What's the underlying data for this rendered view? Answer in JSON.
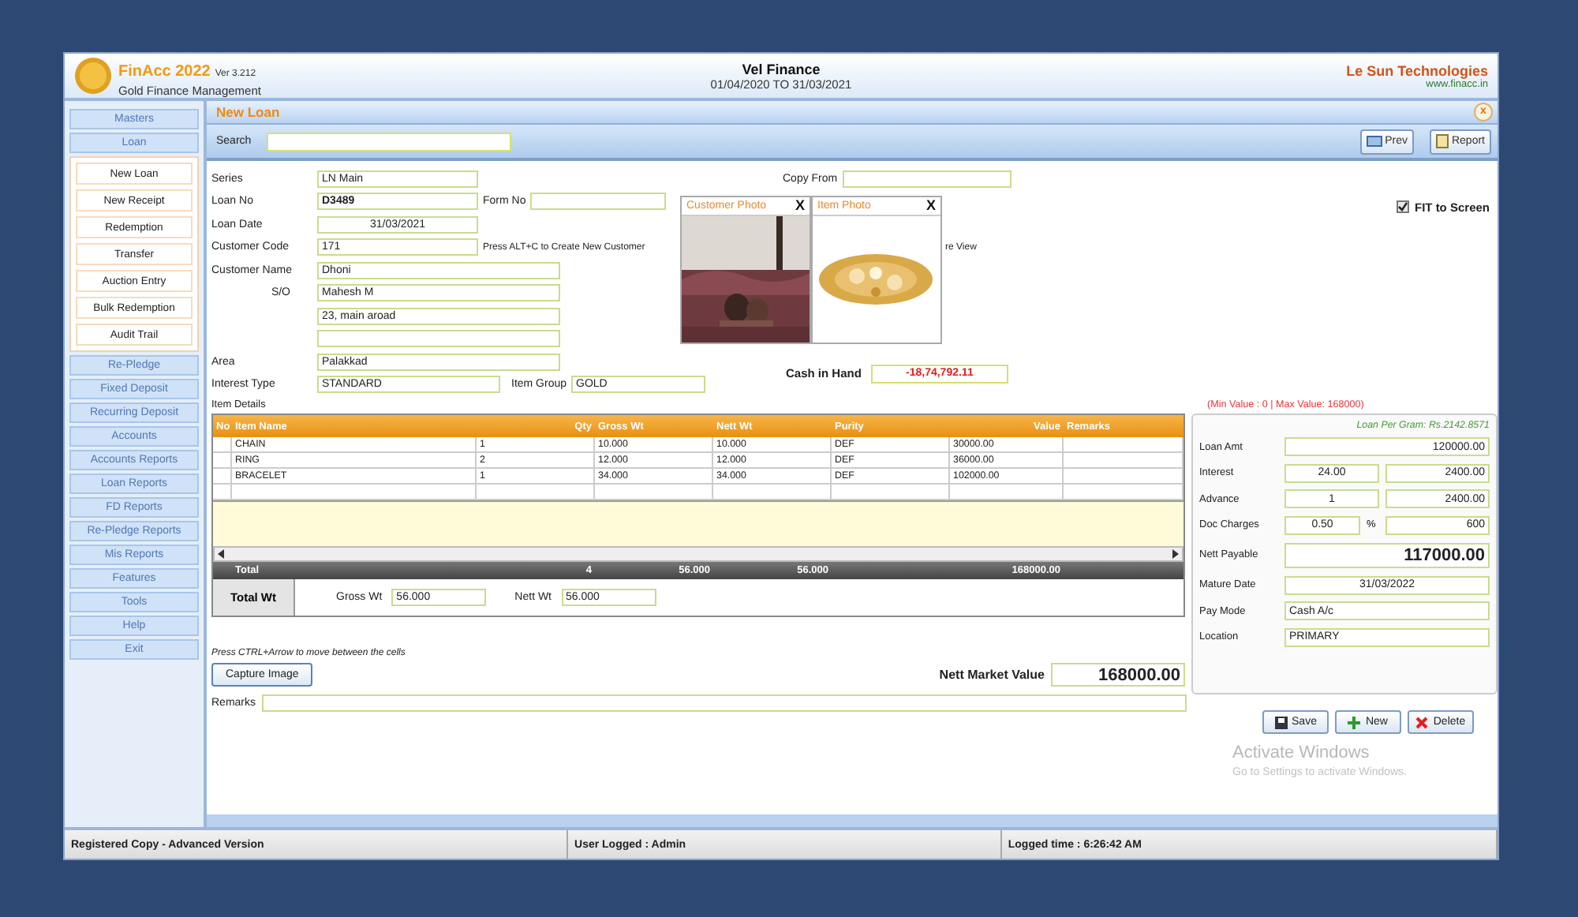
{
  "header": {
    "app_name": "FinAcc 2022",
    "version": "Ver 3.212",
    "subtitle": "Gold Finance Management",
    "company": "Vel Finance",
    "period": "01/04/2020 TO 31/03/2021",
    "vendor": "Le Sun Technologies",
    "website": "www.finacc.in"
  },
  "sidebar": {
    "items": [
      {
        "label": "Masters"
      },
      {
        "label": "Loan",
        "children": [
          {
            "label": "New Loan"
          },
          {
            "label": "New Receipt"
          },
          {
            "label": "Redemption"
          },
          {
            "label": "Transfer"
          },
          {
            "label": "Auction Entry"
          },
          {
            "label": "Bulk Redemption"
          },
          {
            "label": "Audit Trail"
          }
        ]
      },
      {
        "label": "Re-Pledge"
      },
      {
        "label": "Fixed Deposit"
      },
      {
        "label": "Recurring Deposit"
      },
      {
        "label": "Accounts"
      },
      {
        "label": "Accounts Reports"
      },
      {
        "label": "Loan Reports"
      },
      {
        "label": "FD Reports"
      },
      {
        "label": "Re-Pledge Reports"
      },
      {
        "label": "Mis Reports"
      },
      {
        "label": "Features"
      },
      {
        "label": "Tools"
      },
      {
        "label": "Help"
      },
      {
        "label": "Exit"
      }
    ]
  },
  "form": {
    "title": "New Loan",
    "close": "x",
    "search": {
      "label": "Search"
    },
    "toolbar": [
      {
        "label": "Prev",
        "kind": "prev"
      },
      {
        "label": "Report",
        "kind": "report"
      }
    ],
    "series": {
      "label": "Series",
      "value": "LN Main"
    },
    "loan_no": {
      "label": "Loan No",
      "value": "D3489"
    },
    "form_no": {
      "label": "Form No"
    },
    "loan_date": {
      "label": "Loan Date",
      "value": "31/03/2021"
    },
    "customer_code": {
      "label": "Customer Code",
      "value": "171",
      "hint": "Press ALT+C to Create New Customer"
    },
    "customer_name": {
      "label": "Customer Name",
      "value": "Dhoni"
    },
    "relation": {
      "label": "S/O",
      "value": "Mahesh M"
    },
    "address": {
      "lines": [
        "23, main aroad"
      ]
    },
    "area": {
      "label": "Area",
      "value": "Palakkad"
    },
    "interest_type": {
      "label": "Interest Type",
      "value": "STANDARD"
    },
    "item_group": {
      "label": "Item Group",
      "value": "GOLD"
    },
    "copy_from": {
      "label": "Copy From"
    },
    "photos": [
      {
        "title": "Customer Photo",
        "close": "X"
      },
      {
        "title": "Item Photo",
        "close": "X"
      }
    ],
    "hint_tail": "re View",
    "fit_to_screen": {
      "label": "FIT to Screen",
      "checked": true
    },
    "cash_in_hand": {
      "label": "Cash in Hand",
      "value": "-18,74,792.11"
    },
    "items": {
      "title": "Item Details",
      "columns": [
        "No",
        "Item Name",
        "Qty",
        "Gross Wt",
        "Nett Wt",
        "Purity",
        "Value",
        "Remarks"
      ],
      "rows": [
        {
          "item": "CHAIN",
          "qty": "1",
          "gross_wt": "10.000",
          "nett_wt": "10.000",
          "purity": "DEF",
          "value": "30000.00"
        },
        {
          "item": "RING",
          "qty": "2",
          "gross_wt": "12.000",
          "nett_wt": "12.000",
          "purity": "DEF",
          "value": "36000.00"
        },
        {
          "item": "BRACELET",
          "qty": "1",
          "gross_wt": "34.000",
          "nett_wt": "34.000",
          "purity": "DEF",
          "value": "102000.00"
        }
      ],
      "total": {
        "label": "Total",
        "qty": "4",
        "gross_wt": "56.000",
        "nett_wt": "56.000",
        "value": "168000.00"
      }
    },
    "total_wt": {
      "label": "Total Wt",
      "gross_label": "Gross Wt",
      "gross": "56.000",
      "nett_label": "Nett Wt",
      "nett": "56.000"
    },
    "cells_hint": "Press CTRL+Arrow to move between the cells",
    "capture_button": "Capture Image",
    "nett_market_value": {
      "label": "Nett Market Value",
      "value": "168000.00"
    },
    "remarks": {
      "label": "Remarks"
    },
    "loan": {
      "range": "(Min Value : 0 | Max Value: 168000)",
      "per_gram": "Loan Per Gram: Rs.2142.8571",
      "rows": [
        {
          "kind": "single",
          "label": "Loan Amt",
          "value": "120000.00"
        },
        {
          "kind": "pair",
          "label": "Interest",
          "rate": "24.00",
          "amount": "2400.00"
        },
        {
          "kind": "pair",
          "label": "Advance",
          "rate": "1",
          "amount": "2400.00"
        },
        {
          "kind": "percent",
          "label": "Doc Charges",
          "rate": "0.50",
          "unit": "%",
          "amount": "600"
        },
        {
          "kind": "total",
          "label": "Nett Payable",
          "value": "117000.00"
        },
        {
          "kind": "date",
          "label": "Mature Date",
          "value": "31/03/2022"
        },
        {
          "kind": "text",
          "label": "Pay Mode",
          "value": "Cash A/c"
        },
        {
          "kind": "text",
          "label": "Location",
          "value": "PRIMARY"
        }
      ]
    },
    "actions": [
      {
        "label": "Save",
        "kind": "save"
      },
      {
        "label": "New",
        "kind": "new"
      },
      {
        "label": "Delete",
        "kind": "delete"
      }
    ]
  },
  "watermark": {
    "title": "Activate Windows",
    "subtitle": "Go to Settings to activate Windows."
  },
  "status_bar": [
    "Registered Copy - Advanced Version",
    "User Logged : Admin",
    "Logged time : 6:26:42 AM"
  ]
}
